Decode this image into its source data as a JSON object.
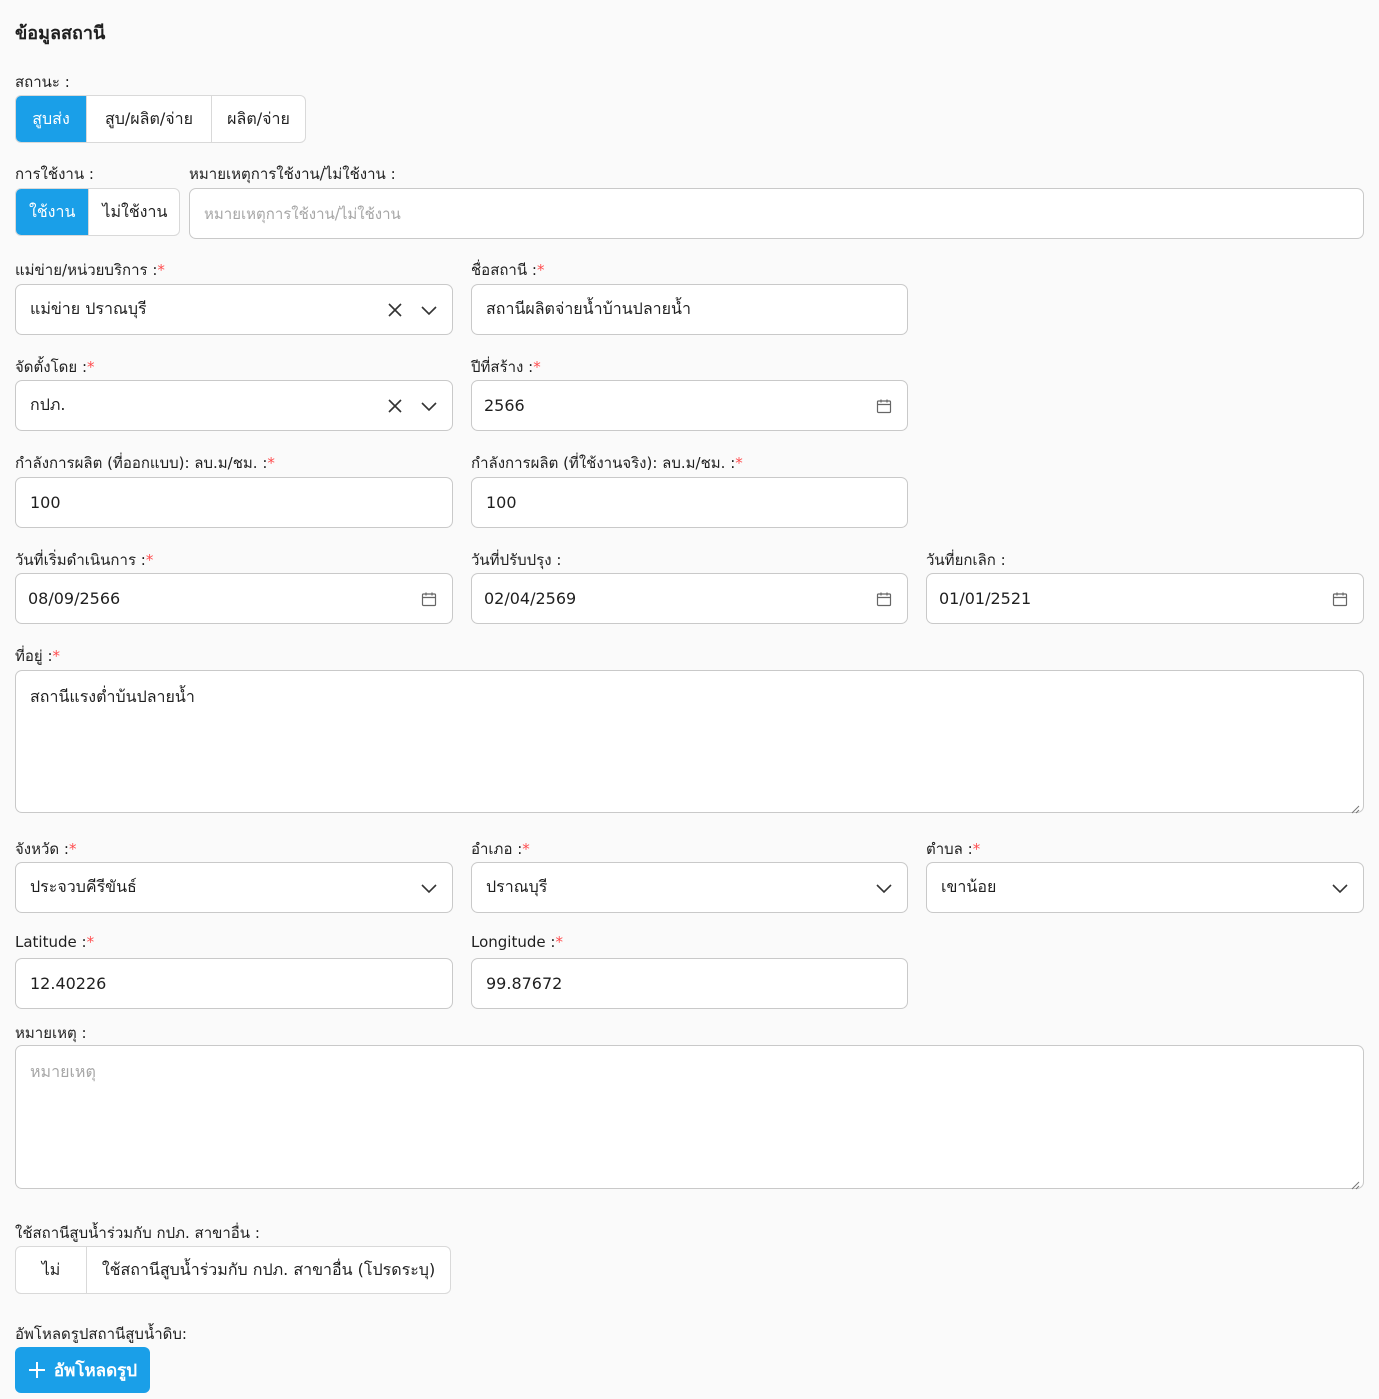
{
  "page_title": "ข้อมูลสถานี",
  "status": {
    "label": "สถานะ :",
    "options": [
      "สูบส่ง",
      "สูบ/ผลิต/จ่าย",
      "ผลิต/จ่าย"
    ],
    "selected": "สูบส่ง"
  },
  "usage": {
    "label": "การใช้งาน :",
    "options": [
      "ใช้งาน",
      "ไม่ใช้งาน"
    ],
    "selected": "ใช้งาน"
  },
  "usage_note": {
    "label": "หมายเหตุการใช้งาน/ไม่ใช้งาน :",
    "placeholder": "หมายเหตุการใช้งาน/ไม่ใช้งาน"
  },
  "service_unit": {
    "label": "แม่ข่าย/หน่วยบริการ :",
    "value": "แม่ข่าย ปราณบุรี"
  },
  "station_name": {
    "label": "ชื่อสถานี :",
    "value": "สถานีผลิตจ่ายน้ำบ้านปลายน้ำ"
  },
  "installed_by": {
    "label": "จัดตั้งโดย :",
    "value": "กปภ."
  },
  "build_year": {
    "label": "ปีที่สร้าง :",
    "value": "2566"
  },
  "capacity_design": {
    "label": "กำลังการผลิต (ที่ออกแบบ): ลบ.ม/ชม. :",
    "value": "100"
  },
  "capacity_actual": {
    "label": "กำลังการผลิต (ที่ใช้งานจริง): ลบ.ม/ชม. :",
    "value": "100"
  },
  "start_date": {
    "label": "วันที่เริ่มดำเนินการ :",
    "value": "08/09/2566"
  },
  "update_date": {
    "label": "วันที่ปรับปรุง :",
    "value": "02/04/2569"
  },
  "cancel_date": {
    "label": "วันที่ยกเลิก :",
    "value": "01/01/2521"
  },
  "address": {
    "label": "ที่อยู่ :",
    "value": "สถานีแรงต่ำบ้นปลายน้ำ"
  },
  "province": {
    "label": "จังหวัด :",
    "value": "ประจวบคีรีขันธ์"
  },
  "district": {
    "label": "อำเภอ :",
    "value": "ปราณบุรี"
  },
  "subdistrict": {
    "label": "ตำบล :",
    "value": "เขาน้อย"
  },
  "latitude": {
    "label": "Latitude :",
    "value": "12.40226"
  },
  "longitude": {
    "label": "Longitude :",
    "value": "99.87672"
  },
  "remark": {
    "label": "หมายเหตุ :",
    "placeholder": "หมายเหตุ"
  },
  "shared": {
    "label": "ใช้สถานีสูบน้ำร่วมกับ กปภ. สาขาอื่น :",
    "options": [
      "ไม่",
      "ใช้สถานีสูบน้ำร่วมกับ กปภ. สาขาอื่น (โปรดระบุ)"
    ]
  },
  "upload": {
    "label": "อัพโหลดรูปสถานีสูบน้ำดิบ:",
    "button": "อัพโหลดรูป"
  },
  "required_mark": "*",
  "colors": {
    "primary": "#1a9fe8",
    "required": "#ff4d4f"
  }
}
